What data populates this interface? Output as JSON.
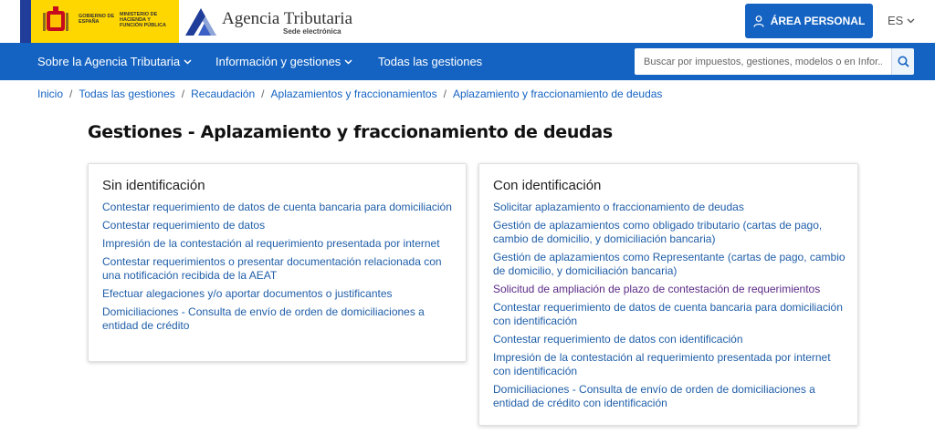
{
  "header": {
    "gov_line1": "GOBIERNO DE ESPAÑA",
    "gov_line2": "MINISTERIO DE HACIENDA Y FUNCIÓN PÚBLICA",
    "agency_name": "Agencia Tributaria",
    "agency_sub": "Sede electrónica",
    "area_personal_label": "ÁREA PERSONAL",
    "language": "ES"
  },
  "nav": {
    "items": [
      {
        "label": "Sobre la Agencia Tributaria",
        "dropdown": true
      },
      {
        "label": "Información y gestiones",
        "dropdown": true
      },
      {
        "label": "Todas las gestiones",
        "dropdown": false
      }
    ],
    "search_placeholder": "Buscar por impuestos, gestiones, modelos o en Infor..."
  },
  "breadcrumb": [
    "Inicio",
    "Todas las gestiones",
    "Recaudación",
    "Aplazamientos y fraccionamientos",
    "Aplazamiento y fraccionamiento de deudas"
  ],
  "page_title": "Gestiones - Aplazamiento y fraccionamiento de deudas",
  "cards": {
    "left": {
      "title": "Sin identificación",
      "links": [
        "Contestar requerimiento de datos de cuenta bancaria para domiciliación",
        "Contestar requerimiento de datos",
        "Impresión de la contestación al requerimiento presentada por internet",
        "Contestar requerimientos o presentar documentación relacionada con una notificación recibida de la AEAT",
        "Efectuar alegaciones y/o aportar documentos o justificantes",
        "Domiciliaciones - Consulta de envío de orden de domiciliaciones a entidad de crédito"
      ]
    },
    "right": {
      "title": "Con identificación",
      "links": [
        "Solicitar aplazamiento o fraccionamiento de deudas",
        "Gestión de aplazamientos como obligado tributario (cartas de pago, cambio de domicilio, y domiciliación bancaria)",
        "Gestión de aplazamientos como Representante (cartas de pago, cambio de domicilio, y domiciliación bancaria)",
        "Solicitud de ampliación de plazo de contestación de requerimientos",
        "Contestar requerimiento de datos de cuenta bancaria para domiciliación con identificación",
        "Contestar requerimiento de datos con identificación",
        "Impresión de la contestación al requerimiento presentada por internet con identificación",
        "Domiciliaciones - Consulta de envío de orden de domiciliaciones a entidad de crédito con identificación"
      ]
    }
  },
  "colors": {
    "brand_blue": "#1463c2",
    "link": "#1f5ea8",
    "visited_link": "#5b2a86",
    "gov_yellow": "#ffd700"
  }
}
